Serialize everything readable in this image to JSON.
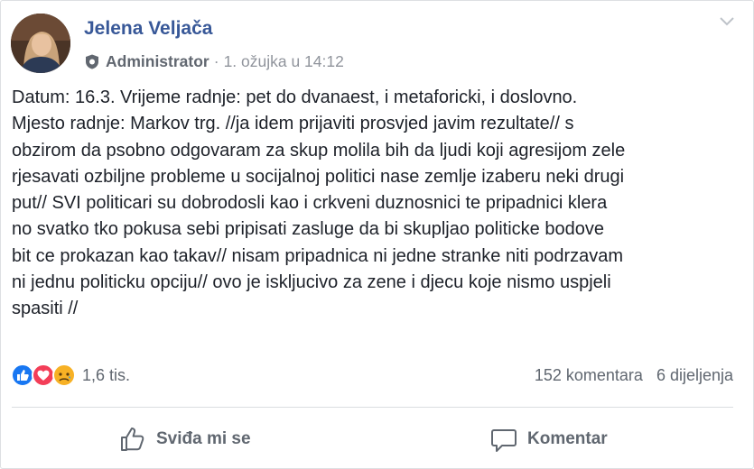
{
  "post": {
    "author": "Jelena Veljača",
    "role": "Administrator",
    "separator": "·",
    "timestamp": "1. ožujka u 14:12",
    "body_lines": [
      "Datum: 16.3. Vrijeme radnje: pet do dvanaest, i metaforicki, i doslovno.",
      "Mjesto radnje: Markov trg. //ja idem prijaviti prosvjed javim rezultate// s",
      "obzirom da psobno odgovaram za skup molila bih da ljudi koji agresijom zele",
      "rjesavati ozbiljne probleme u socijalnoj politici nase zemlje izaberu neki drugi",
      "put// SVI politicari su dobrodosli kao i crkveni duznosnici te pripadnici klera",
      "no svatko tko pokusa sebi pripisati zasluge da bi skupljao politicke bodove",
      "bit ce prokazan kao takav// nisam pripadnica ni jedne stranke niti podrzavam",
      "ni jednu politicku opciju// ovo je iskljucivo za zene i djecu koje nismo uspjeli",
      "spasiti //"
    ]
  },
  "reactions": {
    "icons": [
      "like-reaction-icon",
      "love-reaction-icon",
      "sad-reaction-icon"
    ],
    "count": "1,6 tis."
  },
  "stats": {
    "comments": "152 komentara",
    "shares": "6 dijeljenja"
  },
  "actions": {
    "like_label": "Sviđa mi se",
    "comment_label": "Komentar"
  },
  "colors": {
    "author": "#385898",
    "like_blue": "#1877f2",
    "love_red": "#f33e58",
    "sad_yellow": "#f7b125",
    "muted": "#606770"
  }
}
